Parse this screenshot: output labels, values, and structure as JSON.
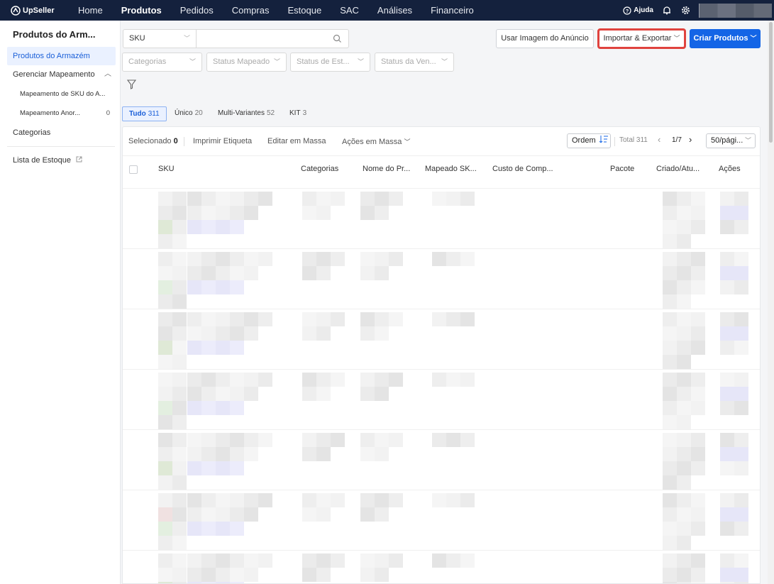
{
  "app": {
    "logo_text": "UpSeller"
  },
  "nav": {
    "items": [
      "Home",
      "Produtos",
      "Pedidos",
      "Compras",
      "Estoque",
      "SAC",
      "Análises",
      "Financeiro"
    ],
    "active": "Produtos",
    "help_label": "Ajuda"
  },
  "sidebar": {
    "title": "Produtos do Arm...",
    "items": [
      {
        "label": "Produtos do Armazém",
        "active": true
      },
      {
        "label": "Gerenciar Mapeamento"
      },
      {
        "label": "Mapeamento de SKU do A..."
      },
      {
        "label": "Mapeamento Anor...",
        "count": "0"
      },
      {
        "label": "Categorias"
      },
      {
        "label": "Lista de Estoque"
      }
    ]
  },
  "filters": {
    "search_type": "SKU",
    "search_value": "",
    "dropdowns": [
      {
        "placeholder": "Categorias"
      },
      {
        "placeholder": "Status Mapeado"
      },
      {
        "placeholder": "Status de Est..."
      },
      {
        "placeholder": "Status da Ven..."
      }
    ]
  },
  "actions": {
    "use_listing_image": "Usar Imagem do Anúncio",
    "import_export": "Importar & Exportar",
    "create_products": "Criar Produtos"
  },
  "tabs": [
    {
      "label": "Tudo",
      "count": "311",
      "active": true
    },
    {
      "label": "Único",
      "count": "20"
    },
    {
      "label": "Multi-Variantes",
      "count": "52"
    },
    {
      "label": "KIT",
      "count": "3"
    }
  ],
  "toolbar": {
    "selected_label": "Selecionado",
    "selected_count": "0",
    "print_label": "Imprimir Etiqueta",
    "bulk_edit": "Editar em Massa",
    "bulk_actions": "Ações em Massa",
    "order": "Ordem",
    "total": "Total 311",
    "page": "1/7",
    "per_page": "50/pági..."
  },
  "table": {
    "columns": [
      "SKU",
      "Categorias",
      "Nome do Pr...",
      "Mapeado SK...",
      "Custo de Comp...",
      "Pacote",
      "Criado/Atu...",
      "Ações"
    ]
  },
  "colors": {
    "nav_bg": "#14213d",
    "primary": "#1465e6",
    "highlight": "#e0433e",
    "active_bg": "#eaf1ff"
  }
}
